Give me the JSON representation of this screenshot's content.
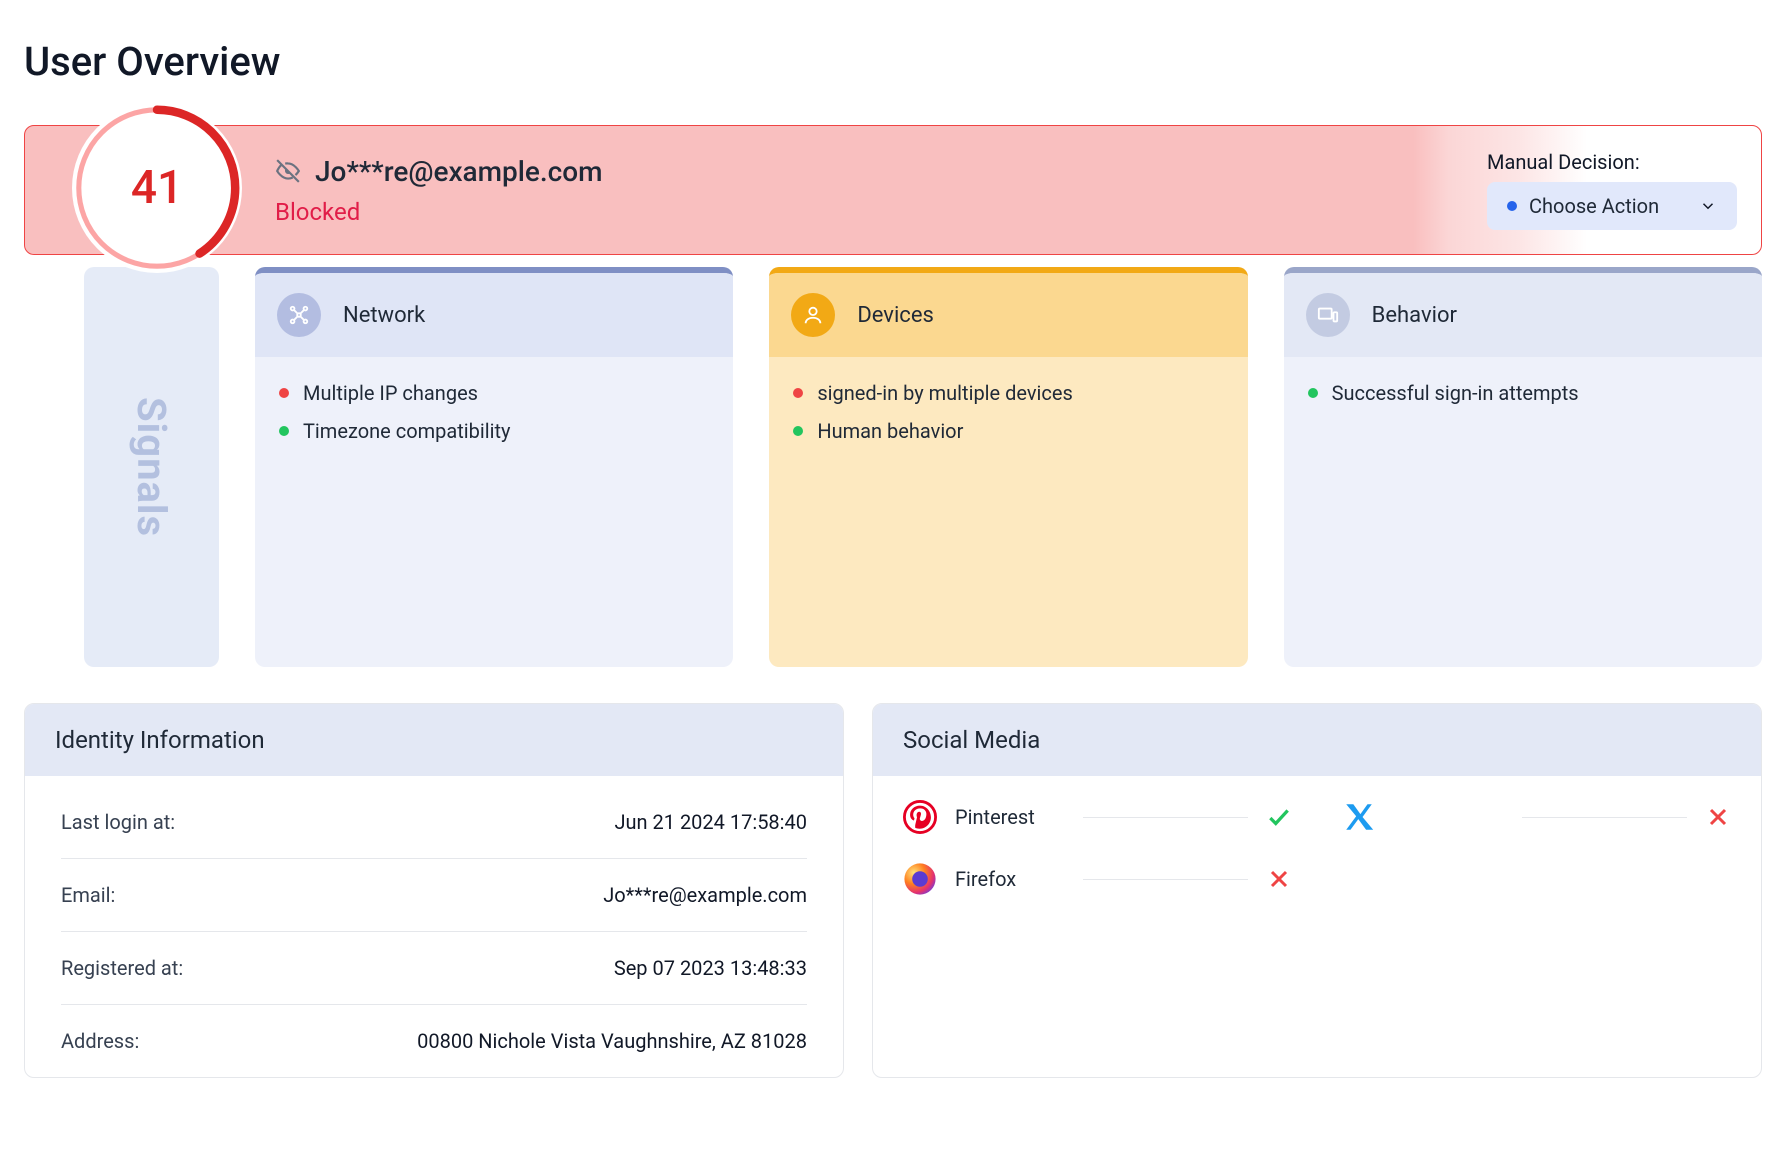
{
  "page": {
    "title": "User Overview"
  },
  "banner": {
    "score": "41",
    "score_pct": 41,
    "email": "Jo***re@example.com",
    "status": "Blocked",
    "manual_label": "Manual Decision:",
    "choose_label": "Choose Action"
  },
  "signals": {
    "tab_label": "Signals",
    "cards": [
      {
        "id": "network",
        "title": "Network",
        "items": [
          {
            "label": "Multiple IP changes",
            "status": "red"
          },
          {
            "label": "Timezone compatibility",
            "status": "green"
          }
        ]
      },
      {
        "id": "devices",
        "title": "Devices",
        "items": [
          {
            "label": "signed-in by multiple devices",
            "status": "red"
          },
          {
            "label": "Human behavior",
            "status": "green"
          }
        ]
      },
      {
        "id": "behavior",
        "title": "Behavior",
        "items": [
          {
            "label": "Successful sign-in attempts",
            "status": "green"
          }
        ]
      }
    ]
  },
  "identity": {
    "title": "Identity Information",
    "rows": [
      {
        "label": "Last login at:",
        "value": "Jun 21 2024 17:58:40"
      },
      {
        "label": "Email:",
        "value": "Jo***re@example.com"
      },
      {
        "label": "Registered at:",
        "value": "Sep 07 2023 13:48:33"
      },
      {
        "label": "Address:",
        "value": "00800 Nichole Vista Vaughnshire, AZ 81028"
      }
    ]
  },
  "social": {
    "title": "Social Media",
    "col1": [
      {
        "icon": "pinterest",
        "name": "Pinterest",
        "status": "check"
      },
      {
        "icon": "firefox",
        "name": "Firefox",
        "status": "x"
      }
    ],
    "col2": [
      {
        "icon": "x-twitter",
        "name": "",
        "status": "x"
      }
    ]
  },
  "colors": {
    "danger": "#ef4444",
    "danger_text": "#e11d48",
    "blue": "#2563eb",
    "green": "#22c55e",
    "amber": "#f2a915",
    "indigo_soft": "#e3e8f5"
  }
}
